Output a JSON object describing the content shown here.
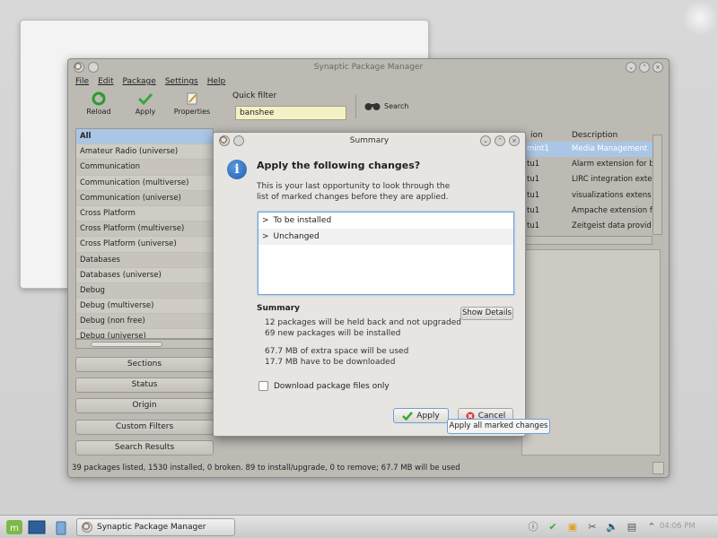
{
  "main_window": {
    "title": "Synaptic Package Manager",
    "menu": [
      "File",
      "Edit",
      "Package",
      "Settings",
      "Help"
    ],
    "toolbar": {
      "reload": "Reload",
      "apply": "Apply",
      "properties": "Properties",
      "quick_filter_label": "Quick filter",
      "quick_filter_value": "banshee",
      "search": "Search"
    },
    "sections": [
      "All",
      "Amateur Radio (universe)",
      "Communication",
      "Communication (multiverse)",
      "Communication (universe)",
      "Cross Platform",
      "Cross Platform (multiverse)",
      "Cross Platform (universe)",
      "Databases",
      "Databases (universe)",
      "Debug",
      "Debug (multiverse)",
      "Debug (non free)",
      "Debug (universe)"
    ],
    "side_buttons": {
      "sections": "Sections",
      "status": "Status",
      "origin": "Origin",
      "custom_filters": "Custom Filters",
      "search_results": "Search Results"
    },
    "package_columns": {
      "version": "ion",
      "description": "Description"
    },
    "packages": [
      {
        "version": "mint1",
        "description": "Media Management"
      },
      {
        "version": "tu1",
        "description": "Alarm extension for b"
      },
      {
        "version": "tu1",
        "description": "LIRC integration exte"
      },
      {
        "version": "tu1",
        "description": "visualizations extens"
      },
      {
        "version": "tu1",
        "description": "Ampache extension fo"
      },
      {
        "version": "tu1",
        "description": "Zeitgeist data provid"
      }
    ],
    "status_text": "39 packages listed, 1530 installed, 0 broken. 89 to install/upgrade, 0 to remove; 67.7 MB will be used"
  },
  "dialog": {
    "title": "Summary",
    "heading": "Apply the following changes?",
    "body": "This is your last opportunity to look through the list of marked changes before they are applied.",
    "changes": [
      {
        "arrow": ">",
        "label": "To be installed"
      },
      {
        "arrow": ">",
        "label": "Unchanged"
      }
    ],
    "summary_title": "Summary",
    "summary_lines": {
      "held": "12 packages will be held back and not upgraded",
      "new": "69 new packages will be installed",
      "space": "67.7 MB of extra space will be used",
      "download": "17.7 MB have to be downloaded"
    },
    "show_details": "Show Details",
    "download_only": "Download package files only",
    "apply": "Apply",
    "cancel": "Cancel",
    "tooltip": "Apply all marked changes"
  },
  "taskbar": {
    "task_label": "Synaptic Package Manager",
    "clock": "04:06 PM"
  },
  "colors": {
    "selection": "#a9c6e6",
    "accent_blue": "#6aa0d8",
    "quick_filter_bg": "#f3f1c6"
  }
}
